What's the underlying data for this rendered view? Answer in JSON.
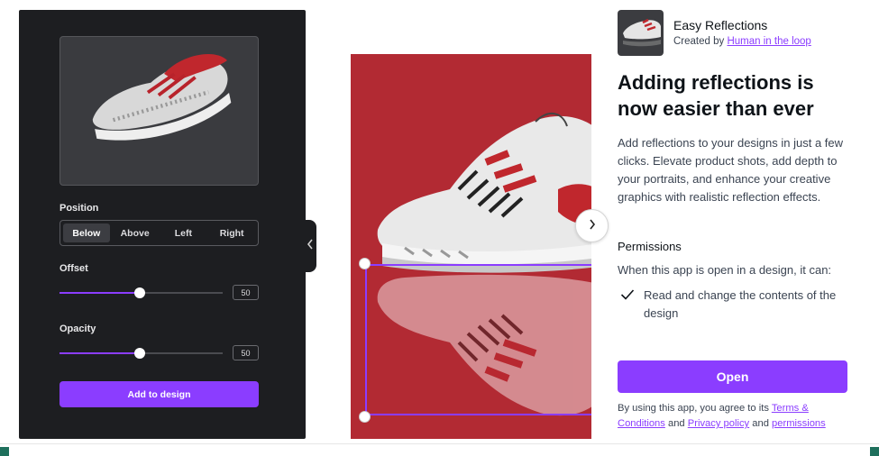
{
  "editor": {
    "position_label": "Position",
    "position_options": [
      "Below",
      "Above",
      "Left",
      "Right"
    ],
    "position_selected": "Below",
    "offset_label": "Offset",
    "offset_value": "50",
    "opacity_label": "Opacity",
    "opacity_value": "50",
    "add_button": "Add to design"
  },
  "app": {
    "name": "Easy Reflections",
    "created_by_prefix": "Created by",
    "author": "Human in the loop",
    "headline": "Adding reflections is now easier than ever",
    "description": "Add reflections to your designs in just a few clicks. Elevate product shots, add depth to your portraits, and enhance your creative graphics with realistic reflection effects.",
    "permissions_title": "Permissions",
    "permissions_intro": "When this app is open in a design, it can:",
    "permission_items": [
      "Read and change the contents of the design"
    ],
    "open_button": "Open",
    "legal_prefix": "By using this app, you agree to its",
    "terms_link": "Terms & Conditions",
    "and1": "and",
    "privacy_link": "Privacy policy",
    "and2": "and",
    "permissions_link": "permissions"
  },
  "colors": {
    "accent": "#8b3dff",
    "preview_bg": "#b22a33",
    "panel_bg": "#1d1e21"
  },
  "icons": [
    "chevron-left-icon",
    "chevron-right-icon",
    "check-icon"
  ]
}
